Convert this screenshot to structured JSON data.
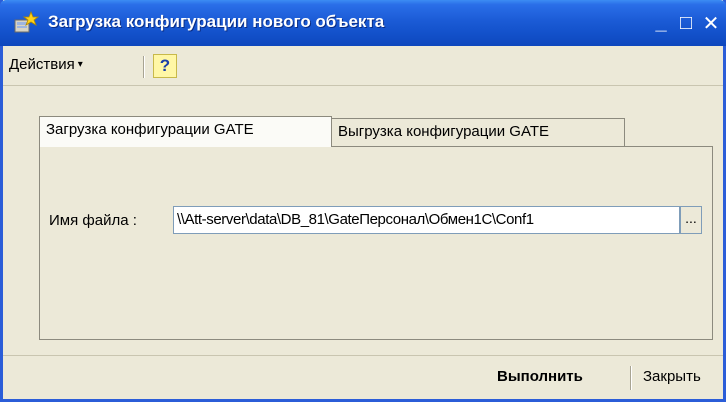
{
  "window": {
    "title": "Загрузка конфигурации нового объекта",
    "icon": "config-load-icon",
    "controls": {
      "minimize": "_",
      "maximize": "□",
      "close": "✕"
    }
  },
  "menu": {
    "actions_label": "Действия",
    "actions_arrow": "▾",
    "help_label": "?"
  },
  "tabs": [
    {
      "label": "Загрузка конфигурации GATE",
      "active": true
    },
    {
      "label": "Выгрузка конфигурации GATE",
      "active": false
    }
  ],
  "form": {
    "file_label": "Имя файла :",
    "file_value": "\\\\Att-server\\data\\DB_81\\GateПерсонал\\Обмен1С\\Conf1",
    "browse_label": "..."
  },
  "footer": {
    "execute_label": "Выполнить",
    "close_label": "Закрыть"
  },
  "colors": {
    "titlebar": "#1b5bd6",
    "window_bg": "#ece9d8",
    "help_bg": "#fff7a6"
  }
}
